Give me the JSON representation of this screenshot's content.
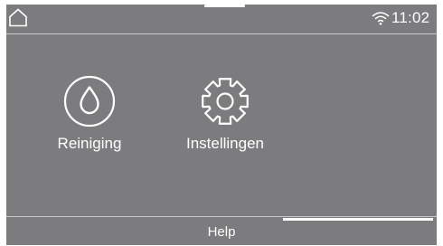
{
  "status_bar": {
    "time": "11:02",
    "icons": [
      "home-icon",
      "wifi-icon"
    ]
  },
  "tiles": [
    {
      "label": "Reiniging",
      "icon": "water-drop-icon"
    },
    {
      "label": "Instellingen",
      "icon": "gear-icon"
    }
  ],
  "footer": {
    "help_label": "Help"
  },
  "colors": {
    "background": "#7c7c7e",
    "foreground": "#ffffff",
    "divider": "#c9c9cb"
  }
}
